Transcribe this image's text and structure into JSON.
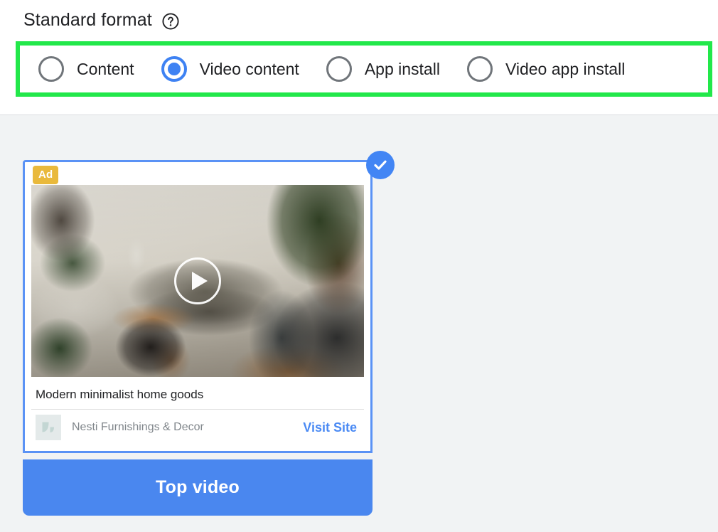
{
  "header": {
    "title": "Standard format",
    "help_icon": "help-circle-icon"
  },
  "format_options": {
    "selected": "Video content",
    "items": [
      {
        "label": "Content",
        "selected": false
      },
      {
        "label": "Video content",
        "selected": true
      },
      {
        "label": "App install",
        "selected": false
      },
      {
        "label": "Video app install",
        "selected": false
      }
    ]
  },
  "highlight": {
    "color": "#22e84a"
  },
  "ad_preview": {
    "selected": true,
    "check_icon": "check-circle-icon",
    "ad_badge": "Ad",
    "ad_badge_color": "#e9b93c",
    "media": {
      "type": "video-thumbnail",
      "play_icon": "play-button-icon",
      "alt": "Living room interior with couch, plants and bookshelf"
    },
    "headline": "Modern minimalist home goods",
    "advertiser_logo_icon": "image-placeholder-icon",
    "advertiser": "Nesti Furnishings & Decor",
    "cta": "Visit Site",
    "cta_color": "#4a8af4",
    "label_bar": {
      "text": "Top video",
      "color": "#4a87ef"
    }
  }
}
